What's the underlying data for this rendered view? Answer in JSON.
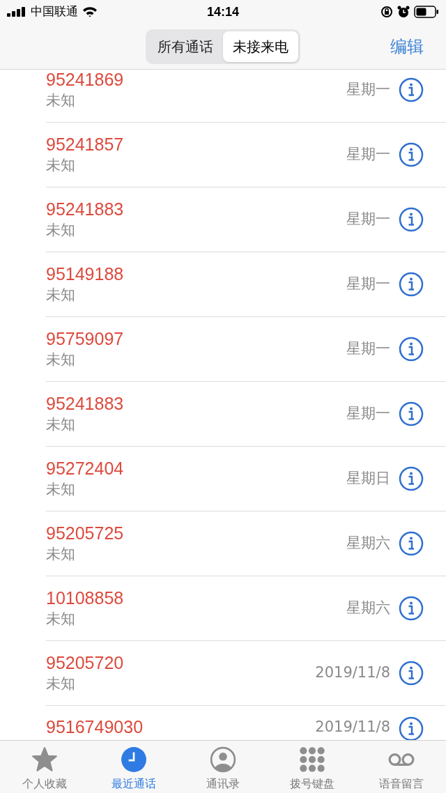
{
  "status_bar": {
    "carrier": "中国联通",
    "time": "14:14"
  },
  "nav": {
    "segments": [
      {
        "label": "所有通话",
        "selected": false
      },
      {
        "label": "未接来电",
        "selected": true
      }
    ],
    "edit": "编辑"
  },
  "calls": [
    {
      "number": "95241869",
      "label": "未知",
      "date": "星期一"
    },
    {
      "number": "95241857",
      "label": "未知",
      "date": "星期一"
    },
    {
      "number": "95241883",
      "label": "未知",
      "date": "星期一"
    },
    {
      "number": "95149188",
      "label": "未知",
      "date": "星期一"
    },
    {
      "number": "95759097",
      "label": "未知",
      "date": "星期一"
    },
    {
      "number": "95241883",
      "label": "未知",
      "date": "星期一"
    },
    {
      "number": "95272404",
      "label": "未知",
      "date": "星期日"
    },
    {
      "number": "95205725",
      "label": "未知",
      "date": "星期六"
    },
    {
      "number": "10108858",
      "label": "未知",
      "date": "星期六"
    },
    {
      "number": "95205720",
      "label": "未知",
      "date": "2019/11/8"
    },
    {
      "number": "9516749030",
      "date": "2019/11/8"
    }
  ],
  "tab_bar": [
    {
      "kind": "star",
      "label": "个人收藏",
      "selected": false
    },
    {
      "kind": "clock",
      "label": "最近通话",
      "selected": true
    },
    {
      "kind": "person",
      "label": "通讯录",
      "selected": false
    },
    {
      "kind": "keypad",
      "label": "拨号键盘",
      "selected": false
    },
    {
      "kind": "voicemail",
      "label": "语音留言",
      "selected": false
    }
  ]
}
